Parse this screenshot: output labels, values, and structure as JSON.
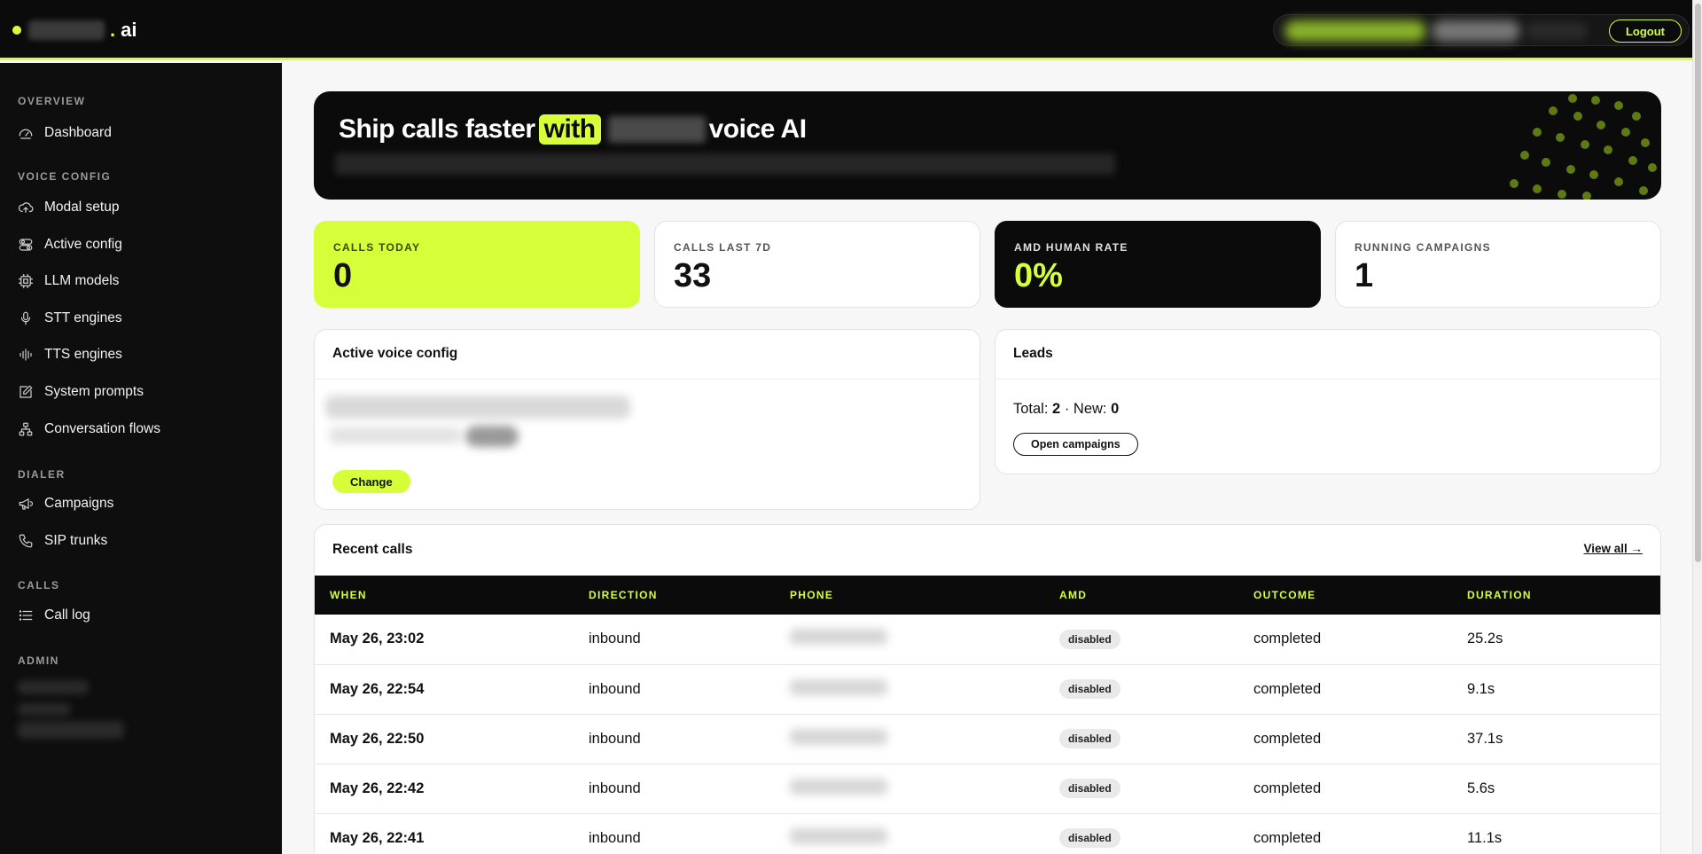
{
  "topbar": {
    "brand_suffix": "ai",
    "logout_label": "Logout"
  },
  "sidebar": {
    "sections": {
      "overview": "OVERVIEW",
      "voice_config": "VOICE CONFIG",
      "dialer": "DIALER",
      "calls": "CALLS",
      "admin": "ADMIN"
    },
    "items": [
      {
        "label": "Dashboard",
        "icon": "gauge-icon"
      },
      {
        "label": "Modal setup",
        "icon": "cloud-upload-icon"
      },
      {
        "label": "Active config",
        "icon": "toggle-icon"
      },
      {
        "label": "LLM models",
        "icon": "cpu-icon"
      },
      {
        "label": "STT engines",
        "icon": "microphone-icon"
      },
      {
        "label": "TTS engines",
        "icon": "audio-waveform-icon"
      },
      {
        "label": "System prompts",
        "icon": "edit-icon"
      },
      {
        "label": "Conversation flows",
        "icon": "flow-icon"
      },
      {
        "label": "Campaigns",
        "icon": "megaphone-icon"
      },
      {
        "label": "SIP trunks",
        "icon": "phone-icon"
      },
      {
        "label": "Call log",
        "icon": "list-icon"
      }
    ]
  },
  "hero": {
    "title_part1": "Ship calls faster",
    "title_highlight": "with",
    "title_part2": "voice AI"
  },
  "kpis": [
    {
      "label": "CALLS TODAY",
      "value": "0"
    },
    {
      "label": "CALLS LAST 7D",
      "value": "33"
    },
    {
      "label": "AMD HUMAN RATE",
      "value": "0%"
    },
    {
      "label": "RUNNING CAMPAIGNS",
      "value": "1"
    }
  ],
  "active_voice_config": {
    "title": "Active voice config",
    "change_label": "Change"
  },
  "leads": {
    "title": "Leads",
    "total_label": "Total:",
    "total": "2",
    "separator": "·",
    "new_label": "New:",
    "new": "0",
    "open_campaigns_label": "Open campaigns"
  },
  "recent_calls": {
    "title": "Recent calls",
    "view_all_label": "View all →",
    "columns": [
      "WHEN",
      "DIRECTION",
      "PHONE",
      "AMD",
      "OUTCOME",
      "DURATION"
    ],
    "rows": [
      {
        "when": "May 26, 23:02",
        "direction": "inbound",
        "amd": "disabled",
        "outcome": "completed",
        "duration": "25.2s"
      },
      {
        "when": "May 26, 22:54",
        "direction": "inbound",
        "amd": "disabled",
        "outcome": "completed",
        "duration": "9.1s"
      },
      {
        "when": "May 26, 22:50",
        "direction": "inbound",
        "amd": "disabled",
        "outcome": "completed",
        "duration": "37.1s"
      },
      {
        "when": "May 26, 22:42",
        "direction": "inbound",
        "amd": "disabled",
        "outcome": "completed",
        "duration": "5.6s"
      },
      {
        "when": "May 26, 22:41",
        "direction": "inbound",
        "amd": "disabled",
        "outcome": "completed",
        "duration": "11.1s"
      }
    ]
  },
  "colors": {
    "accent": "#d6ff3a",
    "dark": "#0b0b0b",
    "background": "#f7f7f7"
  }
}
